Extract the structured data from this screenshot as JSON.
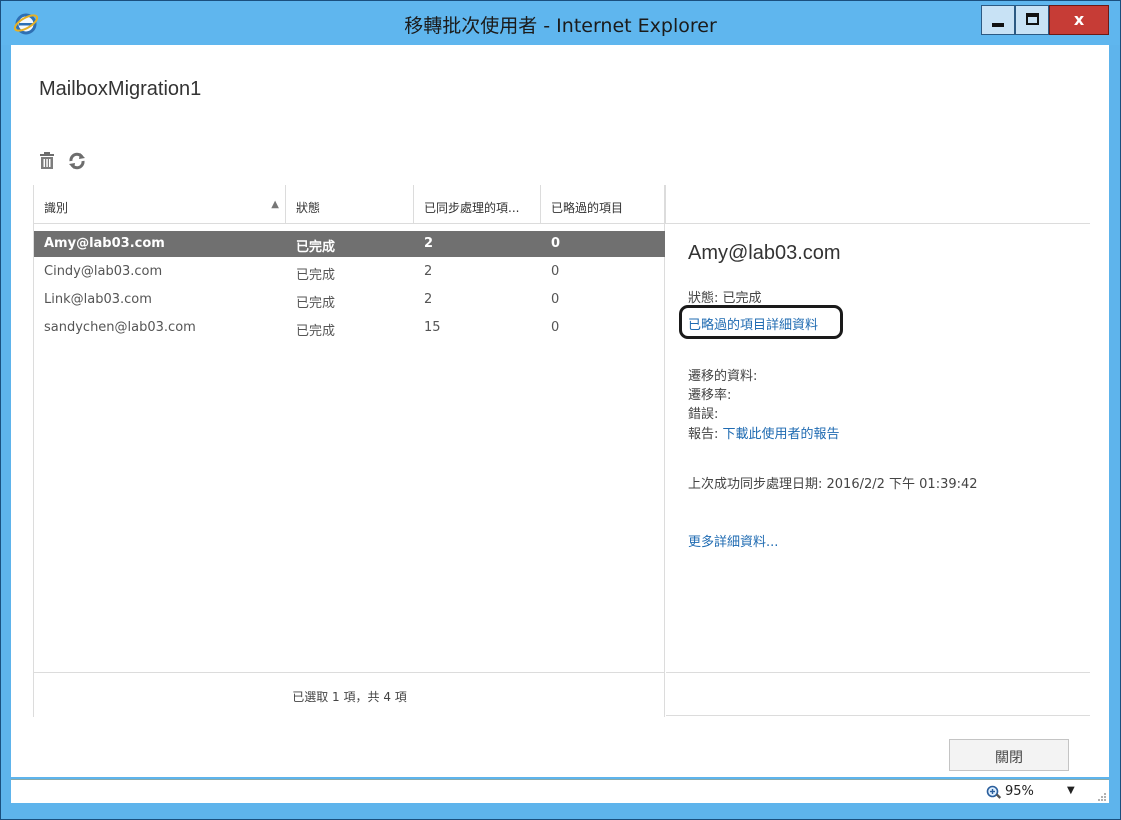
{
  "window": {
    "title": "移轉批次使用者 - Internet Explorer",
    "close_glyph": "x"
  },
  "page": {
    "title": "MailboxMigration1"
  },
  "toolbar": {
    "icons": [
      "trash-icon",
      "refresh-icon"
    ]
  },
  "table": {
    "columns": [
      "識別",
      "狀態",
      "已同步處理的項...",
      "已略過的項目"
    ],
    "sort_indicator": "▲",
    "rows": [
      {
        "id": "Amy@lab03.com",
        "status": "已完成",
        "synced": "2",
        "skipped": "0",
        "selected": true
      },
      {
        "id": "Cindy@lab03.com",
        "status": "已完成",
        "synced": "2",
        "skipped": "0",
        "selected": false
      },
      {
        "id": "Link@lab03.com",
        "status": "已完成",
        "synced": "2",
        "skipped": "0",
        "selected": false
      },
      {
        "id": "sandychen@lab03.com",
        "status": "已完成",
        "synced": "15",
        "skipped": "0",
        "selected": false
      }
    ],
    "footer": "已選取 1 項，共 4 項"
  },
  "detail": {
    "name": "Amy@lab03.com",
    "status_line": "狀態: 已完成",
    "skipped_details_link": "已略過的項目詳細資料",
    "migrated_data_label": "遷移的資料:",
    "migration_rate_label": "遷移率:",
    "errors_label": "錯誤:",
    "report_label": "報告:",
    "report_link": "下載此使用者的報告",
    "last_sync": "上次成功同步處理日期: 2016/2/2 下午 01:39:42",
    "more_details_link": "更多詳細資料..."
  },
  "buttons": {
    "close_label": "關閉"
  },
  "statusbar": {
    "zoom": "95%",
    "zoom_caret": "▼"
  }
}
